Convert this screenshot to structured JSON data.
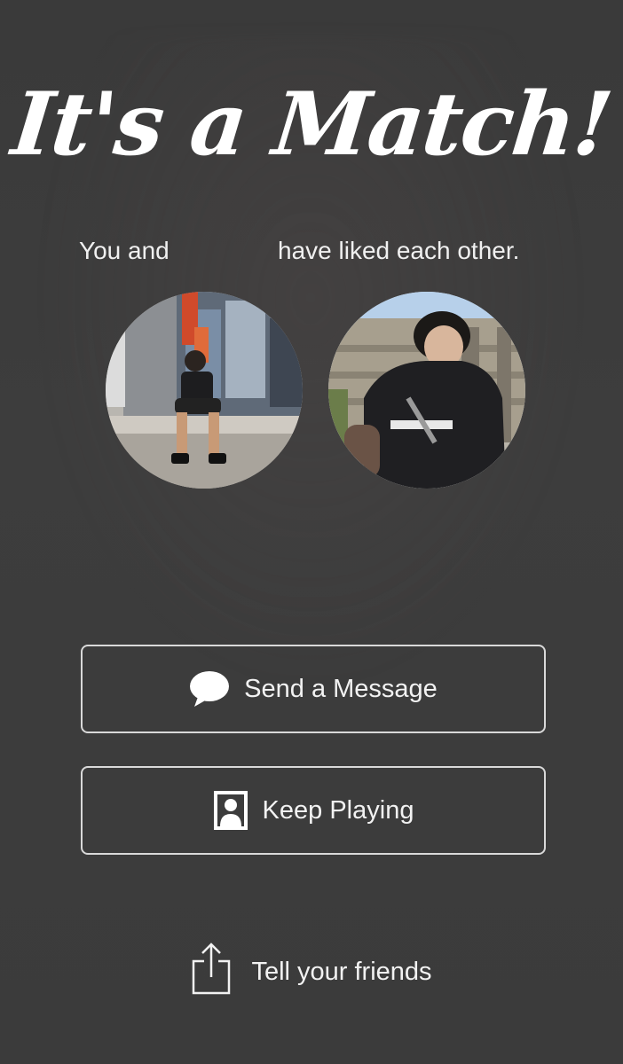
{
  "match": {
    "title": "It's a Match!",
    "subtitle_start": "You and",
    "subtitle_end": "have liked each other."
  },
  "avatars": {
    "left": {
      "description": "profile photo"
    },
    "right": {
      "description": "profile photo"
    }
  },
  "actions": {
    "send_message": "Send a Message",
    "keep_playing": "Keep Playing",
    "tell_friends": "Tell your friends"
  },
  "icons": {
    "send_message": "speech-bubble-icon",
    "keep_playing": "person-portrait-icon",
    "tell_friends": "share-icon"
  },
  "colors": {
    "background": "#3c3c3c",
    "text": "#f2f2f2",
    "button_border": "#d9d9d9"
  }
}
